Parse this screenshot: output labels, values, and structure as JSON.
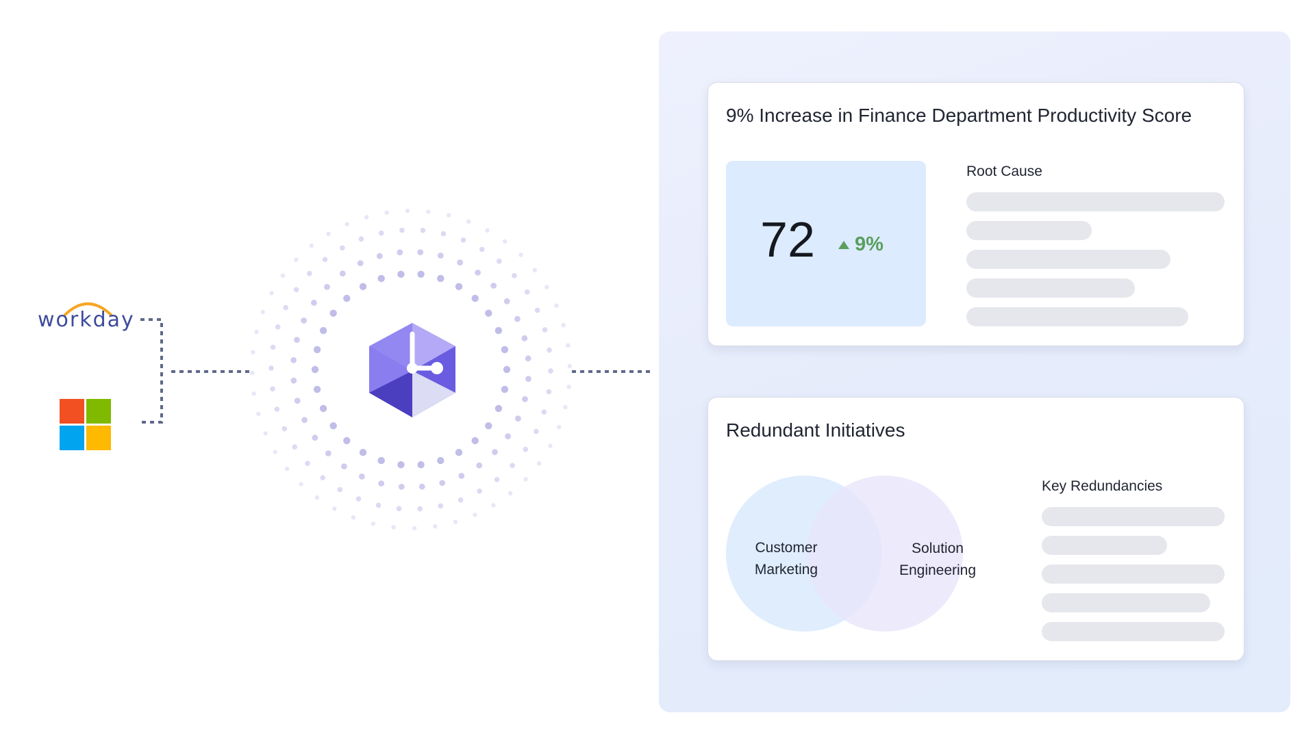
{
  "sources": [
    {
      "name": "workday",
      "wordmark": "workday",
      "icon": "workday-logo",
      "color": "#3e4a9c",
      "accent": "#f5a623"
    },
    {
      "name": "microsoft",
      "icon": "microsoft-logo",
      "colors": [
        "#f25022",
        "#7fba00",
        "#00a4ef",
        "#ffb900"
      ]
    }
  ],
  "hub": {
    "icon": "hexagon-clock-logo",
    "color": "#6a5ce0"
  },
  "productivity_card": {
    "title": "9% Increase in Finance Department Productivity Score",
    "score": "72",
    "change": "9%",
    "change_direction": "up",
    "change_color": "#5a9e5d",
    "root_cause_label": "Root Cause"
  },
  "redundancy_card": {
    "title": "Redundant Initiatives",
    "venn_left": [
      "Customer",
      "Marketing"
    ],
    "venn_right": [
      "Solution",
      "Engineering"
    ],
    "key_redundancies_label": "Key Redundancies"
  }
}
